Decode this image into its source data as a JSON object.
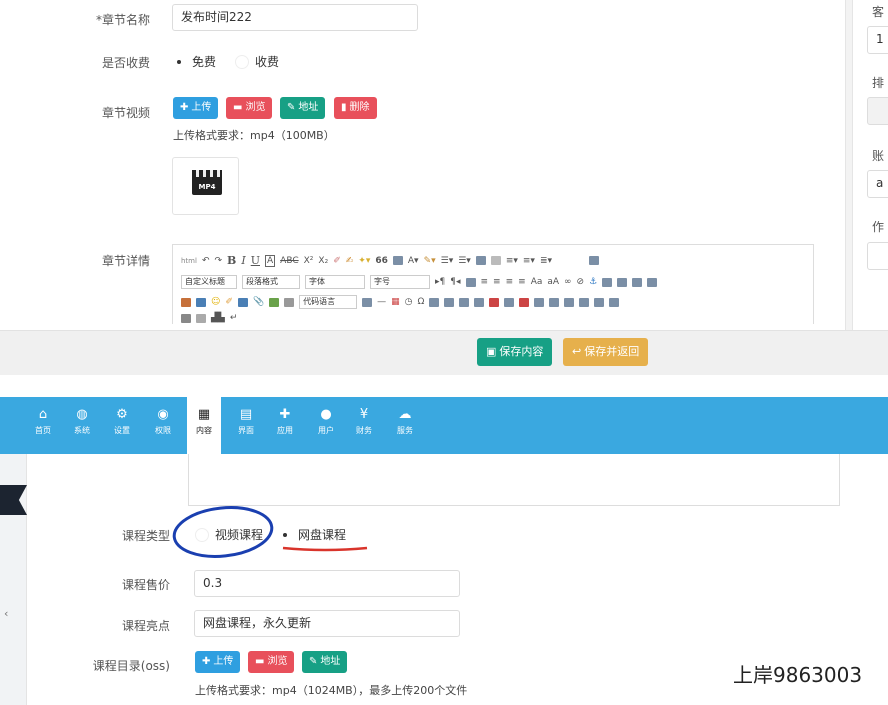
{
  "top_form": {
    "chapter_name": {
      "label": "*章节名称",
      "value": "发布时间222"
    },
    "charge": {
      "label": "是否收费",
      "options": [
        {
          "label": "免费",
          "selected": true
        },
        {
          "label": "收费",
          "selected": false
        }
      ]
    },
    "video": {
      "label": "章节视频",
      "buttons": {
        "upload": "上传",
        "browse": "浏览",
        "address": "地址",
        "delete": "删除"
      },
      "hint": "上传格式要求：mp4（100MB）",
      "thumb_label": "MP4"
    },
    "detail": {
      "label": "章节详情",
      "toolbar": {
        "html": "html",
        "custom_title": "自定义标题",
        "paragraph_format": "段落格式",
        "font_family": "字体",
        "font_size": "字号",
        "code_lang": "代码语言",
        "bold": "B",
        "italic": "I",
        "underline": "U",
        "font_a": "A",
        "quote": "66",
        "omega": "Ω"
      }
    },
    "actions": {
      "save": "保存内容",
      "save_return": "保存并返回"
    }
  },
  "right_panel": {
    "labels": [
      "客",
      "排",
      "账",
      "作"
    ],
    "values": [
      "1",
      "a"
    ]
  },
  "nav": {
    "active": "内容",
    "items": [
      {
        "label": "首页",
        "icon": "home-icon"
      },
      {
        "label": "系统",
        "icon": "globe-icon"
      },
      {
        "label": "设置",
        "icon": "gears-icon"
      },
      {
        "label": "权限",
        "icon": "user-circle-icon"
      },
      {
        "label": "内容",
        "icon": "grid-icon"
      },
      {
        "label": "界面",
        "icon": "html5-icon"
      },
      {
        "label": "应用",
        "icon": "puzzle-icon"
      },
      {
        "label": "用户",
        "icon": "user-icon"
      },
      {
        "label": "财务",
        "icon": "yen-icon"
      },
      {
        "label": "服务",
        "icon": "cloud-icon"
      }
    ]
  },
  "bottom_form": {
    "course_type": {
      "label": "课程类型",
      "options": [
        {
          "label": "视频课程",
          "selected": false
        },
        {
          "label": "网盘课程",
          "selected": true
        }
      ]
    },
    "price": {
      "label": "课程售价",
      "value": "0.3"
    },
    "highlight": {
      "label": "课程亮点",
      "value": "网盘课程，永久更新"
    },
    "directory": {
      "label": "课程目录(oss)",
      "buttons": {
        "upload": "上传",
        "browse": "浏览",
        "address": "地址"
      },
      "hint": "上传格式要求：mp4（1024MB），最多上传200个文件"
    }
  },
  "watermark": "上岸9863003",
  "colors": {
    "nav_bg": "#3aa8e0",
    "nav_active": "#ffffff",
    "blue_btn": "#2f9fe0",
    "red_btn": "#e8505b",
    "green_btn": "#17a085",
    "save_btn": "#17a085",
    "save_return_btn": "#e6b04c",
    "circle_annotation": "#1a3fb0",
    "underline_annotation": "#d9342b"
  }
}
